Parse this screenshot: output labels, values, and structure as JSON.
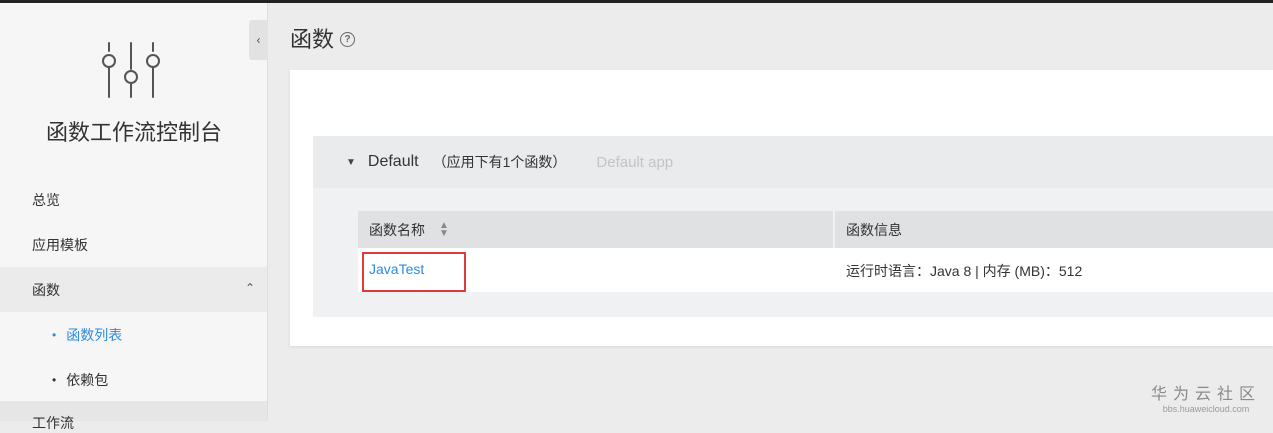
{
  "sidebar": {
    "collapse_icon": "chevron-left-icon",
    "logo_icon": "sliders-icon",
    "title": "函数工作流控制台",
    "items": [
      {
        "label": "总览"
      },
      {
        "label": "应用模板"
      },
      {
        "label": "函数",
        "expanded": true
      }
    ],
    "sub_items": [
      {
        "label": "函数列表",
        "selected": true
      },
      {
        "label": "依赖包",
        "selected": false
      }
    ],
    "next_item": "工作流"
  },
  "main": {
    "page_title": "函数",
    "help_icon": "?",
    "app": {
      "name": "Default",
      "count_text": "（应用下有1个函数）",
      "description": "Default app",
      "expanded": true
    },
    "table": {
      "columns": [
        "函数名称",
        "函数信息"
      ],
      "rows": [
        {
          "name": "JavaTest",
          "info": "运行时语言：Java 8  |  内存 (MB)：512"
        }
      ]
    }
  },
  "watermark": {
    "title": "华为云社区",
    "url": "bbs.huaweicloud.com"
  },
  "colors": {
    "link": "#2d8ce0",
    "highlight": "#e23a3a",
    "sidebar_bg": "#f6f6f6"
  }
}
